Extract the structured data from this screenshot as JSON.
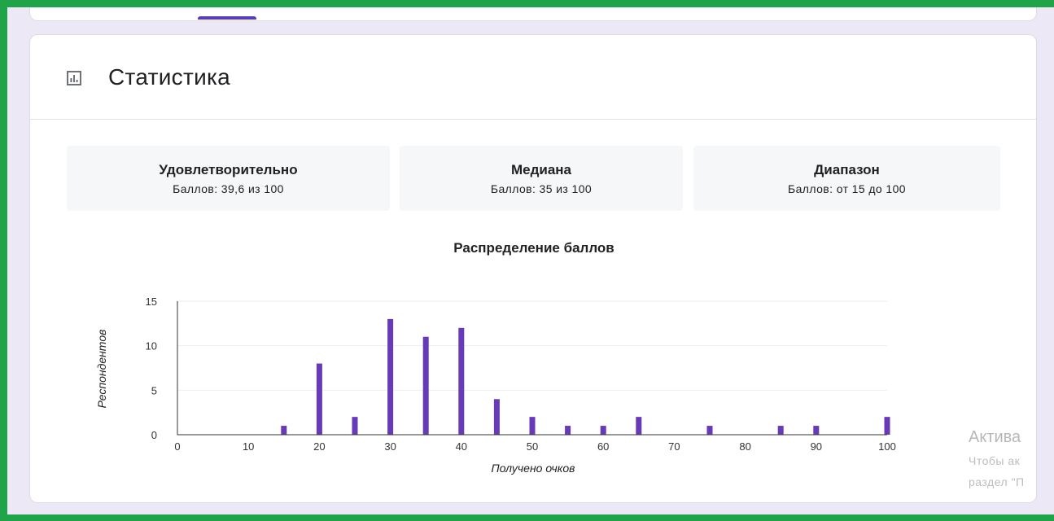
{
  "header": {
    "title": "Статистика",
    "icon": "bar-chart-icon"
  },
  "stats": [
    {
      "title": "Удовлетворительно",
      "value": "Баллов: 39,6 из 100"
    },
    {
      "title": "Медиана",
      "value": "Баллов: 35 из 100"
    },
    {
      "title": "Диапазон",
      "value": "Баллов: от 15 до 100"
    }
  ],
  "colors": {
    "accent": "#673ab7",
    "frame": "#1fa44a",
    "background": "#ede8f6"
  },
  "chart_data": {
    "type": "bar",
    "title": "Распределение баллов",
    "xlabel": "Получено очков",
    "ylabel": "Респондентов",
    "xlim": [
      0,
      100
    ],
    "ylim": [
      0,
      15
    ],
    "x_ticks": [
      0,
      10,
      20,
      30,
      40,
      50,
      60,
      70,
      80,
      90,
      100
    ],
    "y_ticks": [
      0,
      5,
      10,
      15
    ],
    "x": [
      15,
      20,
      25,
      30,
      35,
      40,
      45,
      50,
      55,
      60,
      65,
      75,
      85,
      90,
      100
    ],
    "values": [
      1,
      8,
      2,
      13,
      11,
      12,
      4,
      2,
      1,
      1,
      2,
      1,
      1,
      1,
      2
    ],
    "grid": true,
    "color": "#673ab7"
  },
  "watermark": {
    "line1": "Актива",
    "line2": "Чтобы ак",
    "line3": "раздел \"П"
  }
}
